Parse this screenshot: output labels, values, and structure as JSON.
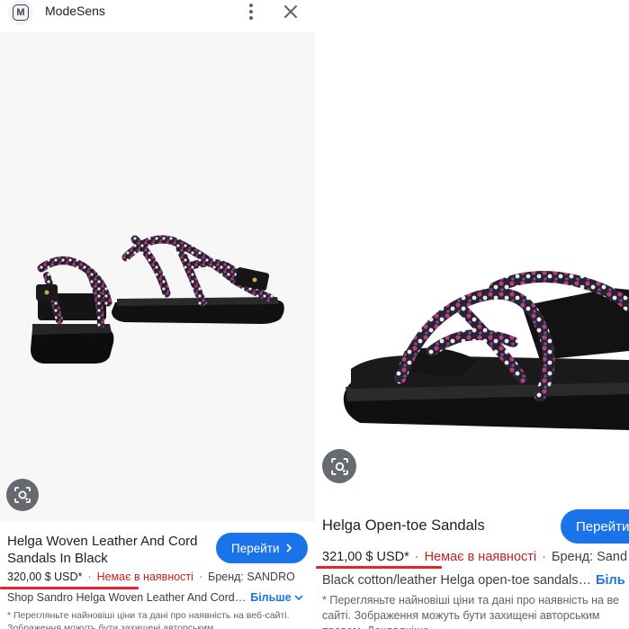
{
  "left": {
    "header": {
      "site_name": "ModeSens",
      "logo_letter": "M",
      "menu_icon": "more-vert-icon",
      "close_icon": "close-icon"
    },
    "lens_icon": "lens-icon",
    "title": "Helga Woven Leather And Cord Sandals In Black",
    "button_label": "Перейти",
    "price": "320,00 $ USD*",
    "availability": "Немає в наявності",
    "brand": "Бренд: SANDRO",
    "description": "Shop Sandro Helga Woven Leather And Cord…",
    "more_label": "Більше",
    "disclaimer": "* Перегляньте найновіші ціни та дані про наявність на веб-сайті. Зображення можуть бути захищені авторським"
  },
  "right": {
    "lens_icon": "lens-icon",
    "title": "Helga Open-toe Sandals",
    "button_label": "Перейти",
    "price": "321,00 $ USD*",
    "availability": "Немає в наявності",
    "brand": "Бренд: Sand",
    "description": "Black cotton/leather Helga open-toe sandals…",
    "more_label": "Біль",
    "disclaimer": "* Перегляньте найновіші ціни та дані про наявність на ве сайті. Зображення можуть бути захищені авторським правом. Докладніше"
  },
  "colors": {
    "accent": "#1a73e8",
    "out_of_stock": "#c5221f",
    "underline": "#e8222b"
  }
}
